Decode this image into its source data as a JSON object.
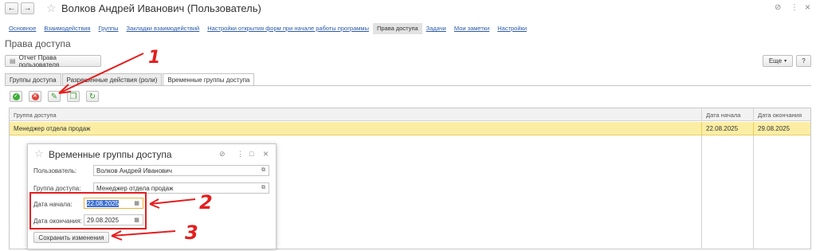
{
  "window": {
    "title": "Волков Андрей Иванович (Пользователь)",
    "back_icon": "←",
    "forward_icon": "→",
    "star_icon": "☆",
    "link_icon": "⊘",
    "more_icon": "⋮",
    "close_icon": "×"
  },
  "nav_tabs": [
    {
      "label": "Основное"
    },
    {
      "label": "Взаимодействия"
    },
    {
      "label": "Группы"
    },
    {
      "label": "Закладки взаимодействий"
    },
    {
      "label": "Настройки открытия форм при начале работы программы"
    },
    {
      "label": "Права доступа"
    },
    {
      "label": "Задачи"
    },
    {
      "label": "Мои заметки"
    },
    {
      "label": "Настройки"
    }
  ],
  "section_title": "Права доступа",
  "report_button": "Отчет Права пользователя",
  "more_button": "Еще",
  "help_button": "?",
  "inner_tabs": [
    {
      "label": "Группы доступа"
    },
    {
      "label": "Разрешенные действия (роли)"
    },
    {
      "label": "Временные группы доступа"
    }
  ],
  "toolbar": {
    "ok_icon": "✓",
    "cancel_icon": "✕",
    "edit_icon": "✎",
    "copy_icon": "❐",
    "refresh_icon": "↻"
  },
  "table": {
    "columns": [
      "Группа доступа",
      "Дата начала",
      "Дата окончания"
    ],
    "rows": [
      {
        "group": "Менеджер отдела продаж",
        "start": "22.08.2025",
        "end": "29.08.2025"
      }
    ]
  },
  "dialog": {
    "title": "Временные группы доступа",
    "user_label": "Пользователь:",
    "user_value": "Волков Андрей Иванович",
    "group_label": "Группа доступа:",
    "group_value": "Менеджер отдела продаж",
    "start_label": "Дата начала:",
    "start_value": "22.08.2025",
    "end_label": "Дата окончания:",
    "end_value": "29.08.2025",
    "save_button": "Сохранить изменения",
    "open_icon": "⧉",
    "calendar_icon": "▦"
  },
  "annotations": [
    "1",
    "2",
    "3"
  ],
  "colors": {
    "highlight_row": "#fbeea4",
    "annotation_red": "#e41e1e",
    "link_blue": "#2a59a8",
    "ok_green": "#3fae3a",
    "cancel_red": "#e0463a"
  }
}
